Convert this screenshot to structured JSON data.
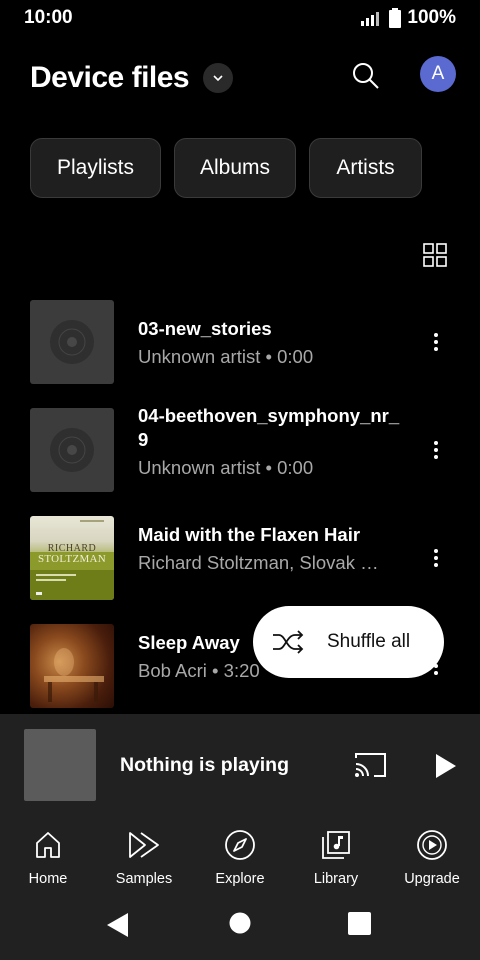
{
  "status_bar": {
    "time": "10:00",
    "battery": "100%"
  },
  "header": {
    "title": "Device files",
    "avatar_letter": "A"
  },
  "chips": [
    {
      "label": "Playlists"
    },
    {
      "label": "Albums"
    },
    {
      "label": "Artists"
    }
  ],
  "songs": [
    {
      "title": "03-new_stories",
      "subtitle": "Unknown artist • 0:00",
      "art": "default"
    },
    {
      "title": "04-beethoven_symphony_nr_9",
      "subtitle": "Unknown artist • 0:00",
      "art": "default"
    },
    {
      "title": "Maid with the Flaxen Hair",
      "subtitle": "Richard Stoltzman, Slovak …",
      "art": "stoltzman",
      "art_text_top": "RICHARD",
      "art_text_bottom": "STOLTZMAN"
    },
    {
      "title": "Sleep Away",
      "subtitle": "Bob Acri • 3:20",
      "art": "bob-acri"
    }
  ],
  "shuffle": {
    "label": "Shuffle all"
  },
  "mini_player": {
    "title": "Nothing is playing"
  },
  "bottom_nav": [
    {
      "label": "Home",
      "icon": "home-icon"
    },
    {
      "label": "Samples",
      "icon": "samples-icon"
    },
    {
      "label": "Explore",
      "icon": "explore-icon"
    },
    {
      "label": "Library",
      "icon": "library-icon"
    },
    {
      "label": "Upgrade",
      "icon": "upgrade-icon"
    }
  ],
  "colors": {
    "background": "#000000",
    "surface": "#212121",
    "chip": "#1f1f1f",
    "avatar": "#5a6ad0",
    "secondary_text": "#a8a8a8"
  }
}
